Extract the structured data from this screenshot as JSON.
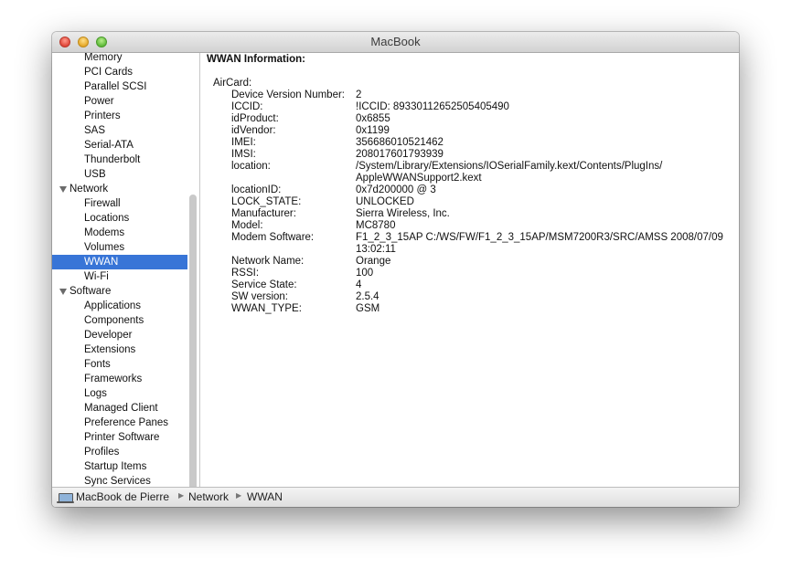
{
  "window": {
    "title": "MacBook"
  },
  "sidebar": {
    "items": [
      {
        "label": "Memory",
        "kind": "child"
      },
      {
        "label": "PCI Cards",
        "kind": "child"
      },
      {
        "label": "Parallel SCSI",
        "kind": "child"
      },
      {
        "label": "Power",
        "kind": "child"
      },
      {
        "label": "Printers",
        "kind": "child"
      },
      {
        "label": "SAS",
        "kind": "child"
      },
      {
        "label": "Serial-ATA",
        "kind": "child"
      },
      {
        "label": "Thunderbolt",
        "kind": "child"
      },
      {
        "label": "USB",
        "kind": "child"
      },
      {
        "label": "Network",
        "kind": "parent"
      },
      {
        "label": "Firewall",
        "kind": "child"
      },
      {
        "label": "Locations",
        "kind": "child"
      },
      {
        "label": "Modems",
        "kind": "child"
      },
      {
        "label": "Volumes",
        "kind": "child"
      },
      {
        "label": "WWAN",
        "kind": "child",
        "selected": true
      },
      {
        "label": "Wi-Fi",
        "kind": "child"
      },
      {
        "label": "Software",
        "kind": "parent"
      },
      {
        "label": "Applications",
        "kind": "child"
      },
      {
        "label": "Components",
        "kind": "child"
      },
      {
        "label": "Developer",
        "kind": "child"
      },
      {
        "label": "Extensions",
        "kind": "child"
      },
      {
        "label": "Fonts",
        "kind": "child"
      },
      {
        "label": "Frameworks",
        "kind": "child"
      },
      {
        "label": "Logs",
        "kind": "child"
      },
      {
        "label": "Managed Client",
        "kind": "child"
      },
      {
        "label": "Preference Panes",
        "kind": "child"
      },
      {
        "label": "Printer Software",
        "kind": "child"
      },
      {
        "label": "Profiles",
        "kind": "child"
      },
      {
        "label": "Startup Items",
        "kind": "child"
      },
      {
        "label": "Sync Services",
        "kind": "child"
      }
    ]
  },
  "content": {
    "title": "WWAN Information:",
    "section": "AirCard:",
    "rows": [
      {
        "key": "Device Version Number:",
        "value": "2"
      },
      {
        "key": "ICCID:",
        "value": "!ICCID: 89330112652505405490"
      },
      {
        "key": "idProduct:",
        "value": "0x6855"
      },
      {
        "key": "idVendor:",
        "value": "0x1199"
      },
      {
        "key": "IMEI:",
        "value": "356686010521462"
      },
      {
        "key": "IMSI:",
        "value": "208017601793939"
      },
      {
        "key": "location:",
        "value": "/System/Library/Extensions/IOSerialFamily.kext/Contents/PlugIns/ AppleWWANSupport2.kext"
      },
      {
        "key": "locationID:",
        "value": "0x7d200000 @ 3"
      },
      {
        "key": "LOCK_STATE:",
        "value": "UNLOCKED"
      },
      {
        "key": "Manufacturer:",
        "value": "Sierra Wireless, Inc."
      },
      {
        "key": "Model:",
        "value": "MC8780"
      },
      {
        "key": "Modem Software:",
        "value": "F1_2_3_15AP C:/WS/FW/F1_2_3_15AP/MSM7200R3/SRC/AMSS 2008/07/09 13:02:11"
      },
      {
        "key": "Network Name:",
        "value": "Orange"
      },
      {
        "key": "RSSI:",
        "value": "100"
      },
      {
        "key": "Service State:",
        "value": "4"
      },
      {
        "key": "SW version:",
        "value": "2.5.4"
      },
      {
        "key": "WWAN_TYPE:",
        "value": "GSM"
      }
    ]
  },
  "statusbar": {
    "icon": "laptop-icon",
    "crumbs": [
      "MacBook de Pierre",
      "Network",
      "WWAN"
    ],
    "separator": "▶"
  }
}
